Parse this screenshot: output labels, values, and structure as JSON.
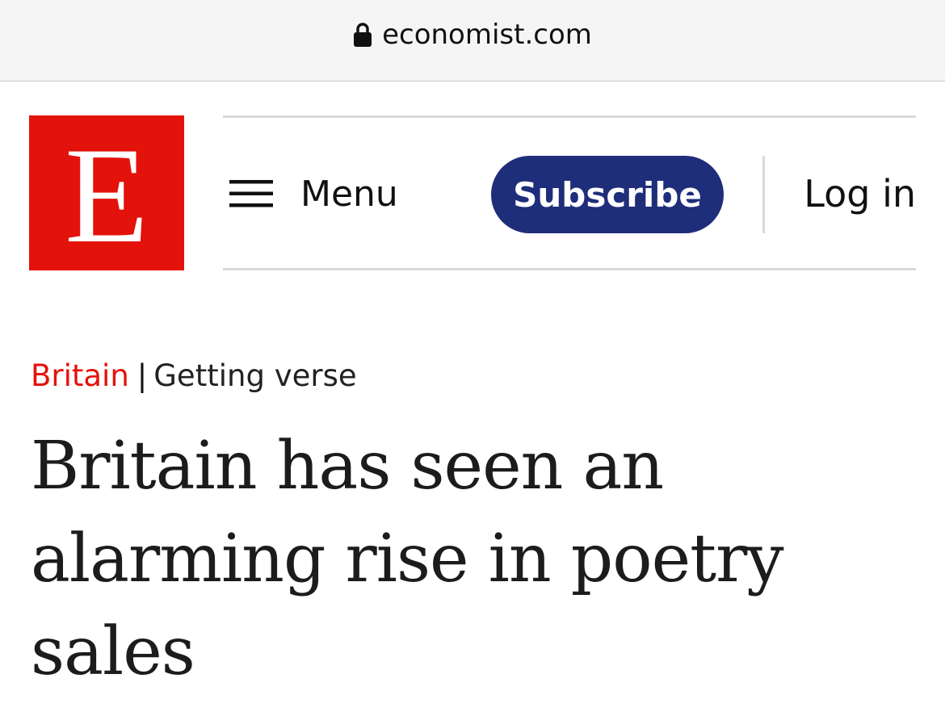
{
  "browser": {
    "domain": "economist.com",
    "lock_icon": "lock-icon"
  },
  "header": {
    "logo_letter": "E",
    "logo_color": "#e3120b",
    "menu_label": "Menu",
    "menu_icon": "hamburger-icon",
    "subscribe_label": "Subscribe",
    "subscribe_color": "#1f2e7a",
    "login_label": "Log in"
  },
  "article": {
    "section": "Britain",
    "separator": "|",
    "fly_title": "Getting verse",
    "headline": "Britain has seen an alarming rise in poetry sales"
  }
}
